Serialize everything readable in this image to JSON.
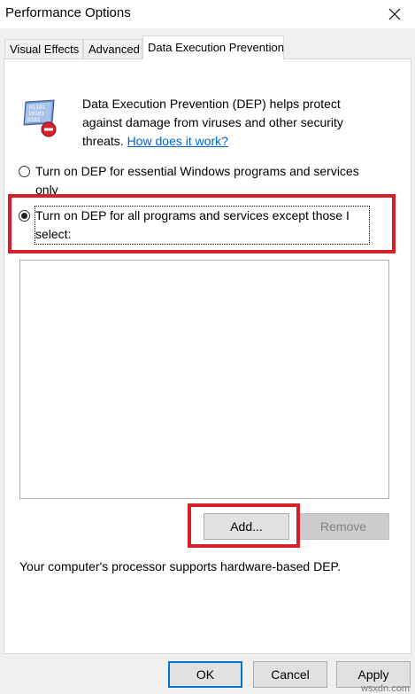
{
  "window": {
    "title": "Performance Options"
  },
  "tabs": [
    {
      "label": "Visual Effects"
    },
    {
      "label": "Advanced"
    },
    {
      "label": "Data Execution Prevention"
    }
  ],
  "description": {
    "text": "Data Execution Prevention (DEP) helps protect against damage from viruses and other security threats. ",
    "link": "How does it work?"
  },
  "options": {
    "essential": "Turn on DEP for essential Windows programs and services only",
    "all": "Turn on DEP for all programs and services except those I select:",
    "selected": "all"
  },
  "buttons": {
    "add": "Add...",
    "remove": "Remove",
    "ok": "OK",
    "cancel": "Cancel",
    "apply": "Apply"
  },
  "support_text": "Your computer's processor supports hardware-based DEP.",
  "watermark": "wsxdn.com",
  "colors": {
    "highlight": "#d6202a",
    "link": "#0066cc",
    "focus_border": "#0078d7"
  },
  "icons": {
    "close": "close-icon",
    "dep": "dep-icon"
  }
}
